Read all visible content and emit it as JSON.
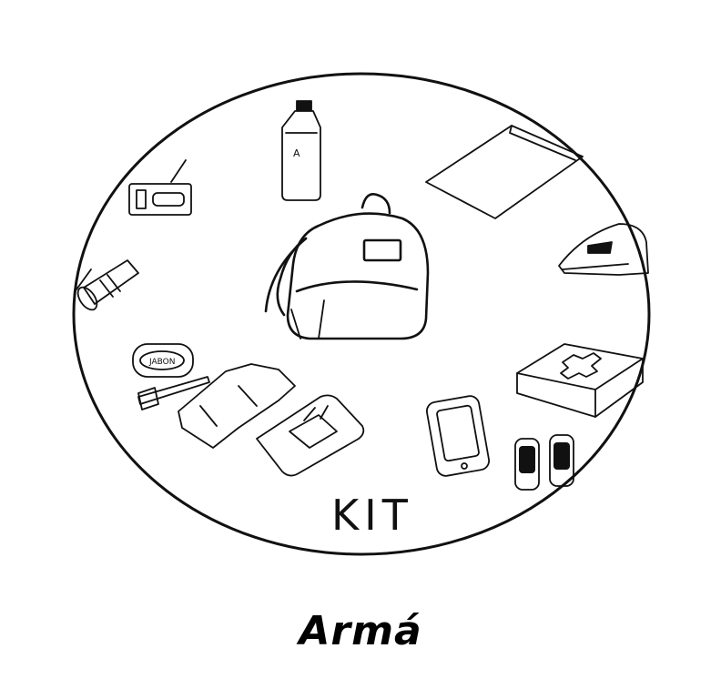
{
  "illustration": {
    "kit_label": "KIT",
    "items": [
      "water-bottle",
      "backpack",
      "radio",
      "flashlight",
      "soap",
      "toothbrush",
      "towel",
      "wet-wipes",
      "mobile-phone",
      "batteries",
      "first-aid-kit",
      "document-folder",
      "sleeping-mat"
    ]
  },
  "caption": "Armá"
}
